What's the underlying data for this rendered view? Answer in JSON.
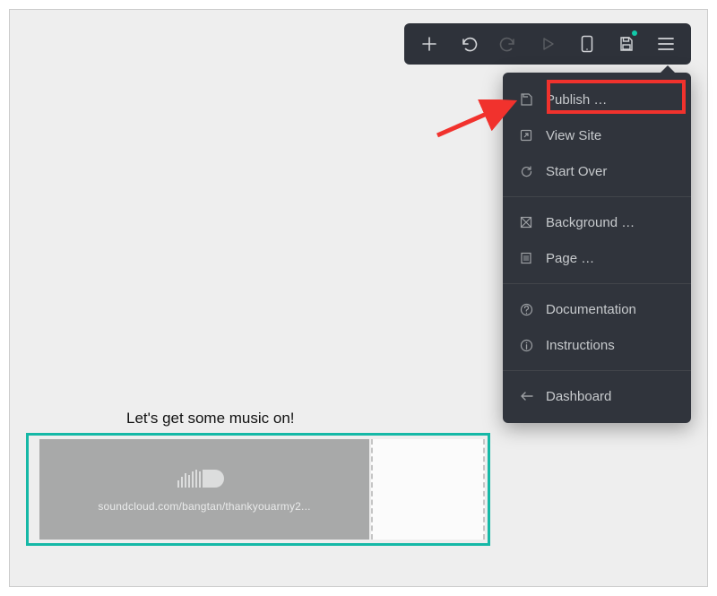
{
  "content": {
    "heading": "Let's get some music on!",
    "embed_url": "soundcloud.com/bangtan/thankyouarmy2..."
  },
  "menu": {
    "publish": "Publish …",
    "view_site": "View Site",
    "start_over": "Start Over",
    "background": "Background …",
    "page": "Page …",
    "documentation": "Documentation",
    "instructions": "Instructions",
    "dashboard": "Dashboard"
  },
  "colors": {
    "accent": "#15b8a6",
    "annotation": "#f1322d",
    "toolbar_bg": "#2e323a",
    "dropdown_bg": "#30343c"
  }
}
